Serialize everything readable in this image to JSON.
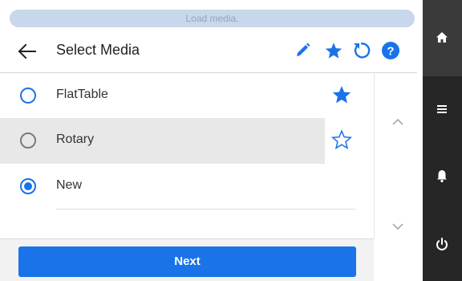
{
  "status": {
    "message": "Load media."
  },
  "header": {
    "title": "Select Media",
    "back_icon": "arrow-left-icon",
    "actions": [
      "pencil-icon",
      "star-icon",
      "reset-icon",
      "help-icon"
    ]
  },
  "media_list": {
    "items": [
      {
        "label": "FlatTable",
        "selected": false,
        "favorite": true
      },
      {
        "label": "Rotary",
        "selected": false,
        "favorite": false
      },
      {
        "label": "New",
        "selected": true,
        "favorite": false
      }
    ]
  },
  "scroll": {
    "up_icon": "chevron-up-icon",
    "down_icon": "chevron-down-icon"
  },
  "footer": {
    "next_label": "Next"
  },
  "sidebar": {
    "icons": [
      "home-icon",
      "menu-icon",
      "bell-icon",
      "power-icon"
    ]
  },
  "colors": {
    "accent": "#1a73e8",
    "sidebar": "#262626",
    "status_pill": "#c8d7ea"
  }
}
